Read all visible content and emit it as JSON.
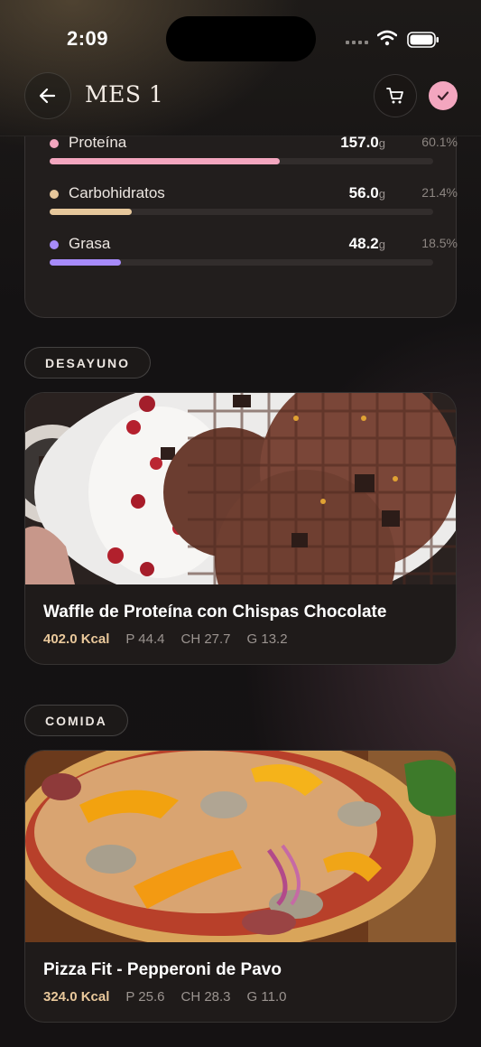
{
  "status_bar": {
    "time": "2:09"
  },
  "header": {
    "title": "MES 1"
  },
  "colors": {
    "protein": "#f3a6bf",
    "carbs": "#e6c79b",
    "fat": "#a78bfa",
    "kcal": "#e9c89b",
    "accent": "#f3a6bf"
  },
  "macros": [
    {
      "label": "Proteína",
      "grams": "157.0",
      "unit": "g",
      "percent": "60.1%",
      "fraction": 0.601
    },
    {
      "label": "Carbohidratos",
      "grams": "56.0",
      "unit": "g",
      "percent": "21.4%",
      "fraction": 0.214
    },
    {
      "label": "Grasa",
      "grams": "48.2",
      "unit": "g",
      "percent": "18.5%",
      "fraction": 0.185
    }
  ],
  "sections": [
    {
      "chip": "DESAYUNO",
      "meal": {
        "name": "Waffle de Proteína con Chispas Chocolate",
        "kcal": "402.0 Kcal",
        "protein": "P 44.4",
        "carbs": "CH 27.7",
        "fat": "G 13.2"
      }
    },
    {
      "chip": "COMIDA",
      "meal": {
        "name": "Pizza Fit - Pepperoni de Pavo",
        "kcal": "324.0 Kcal",
        "protein": "P 25.6",
        "carbs": "CH 28.3",
        "fat": "G 11.0"
      }
    }
  ],
  "icons": {
    "back": "arrow-left-icon",
    "cart": "cart-icon",
    "check": "check-icon",
    "wifi": "wifi-icon",
    "battery": "battery-icon",
    "signal": "signal-icon"
  }
}
